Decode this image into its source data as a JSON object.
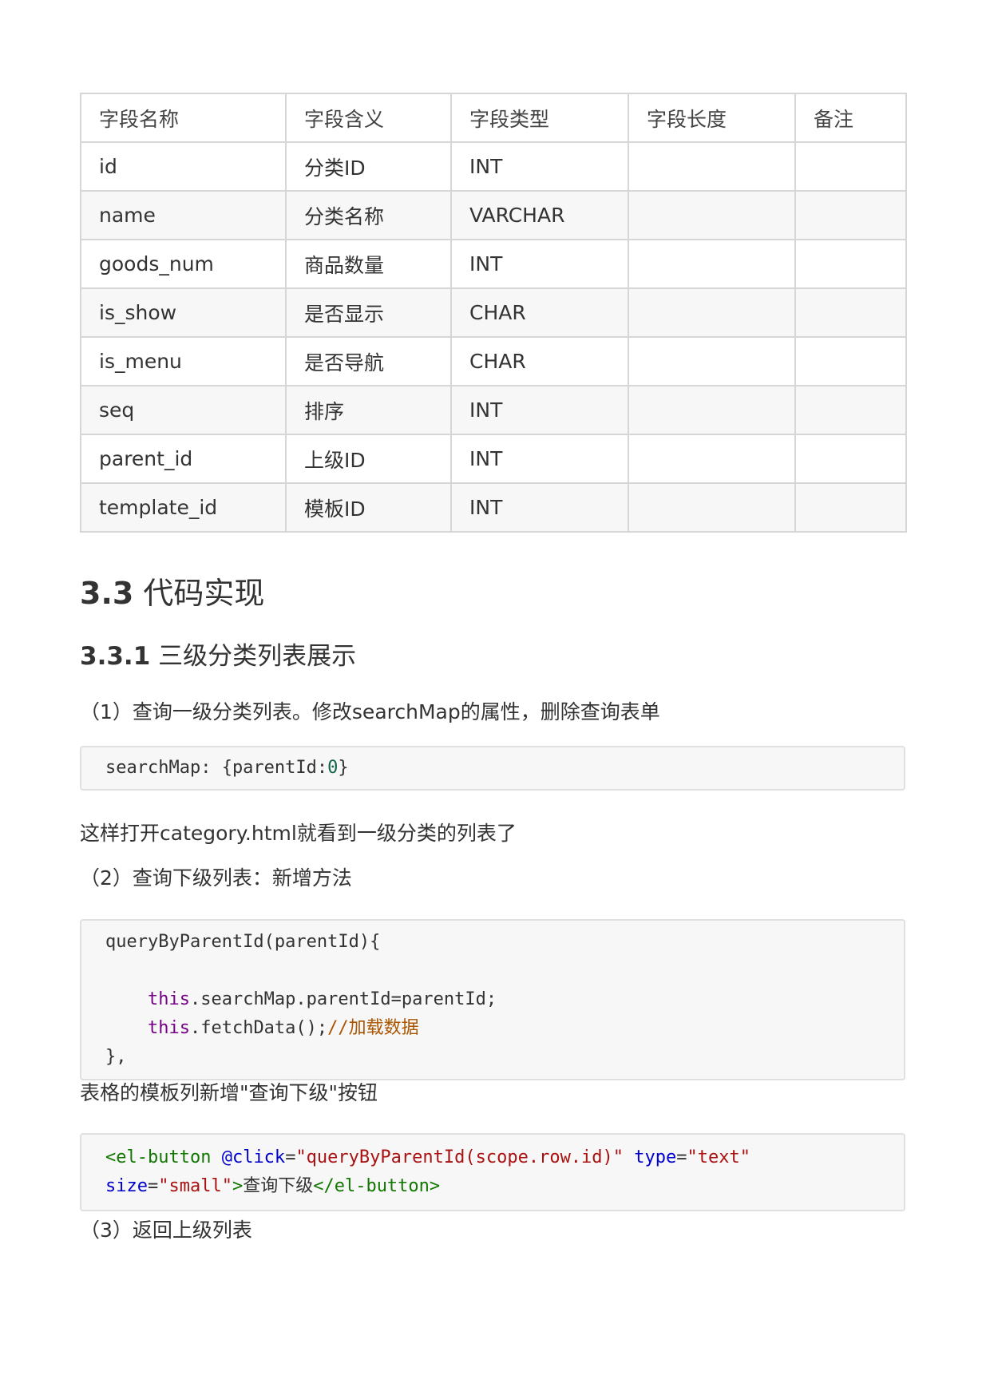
{
  "table": {
    "headers": [
      "字段名称",
      "字段含义",
      "字段类型",
      "字段长度",
      "备注"
    ],
    "rows": [
      [
        "id",
        "分类ID",
        "INT",
        "",
        ""
      ],
      [
        "name",
        "分类名称",
        "VARCHAR",
        "",
        ""
      ],
      [
        "goods_num",
        "商品数量",
        "INT",
        "",
        ""
      ],
      [
        "is_show",
        "是否显示",
        "CHAR",
        "",
        ""
      ],
      [
        "is_menu",
        "是否导航",
        "CHAR",
        "",
        ""
      ],
      [
        "seq",
        "排序",
        "INT",
        "",
        ""
      ],
      [
        "parent_id",
        "上级ID",
        "INT",
        "",
        ""
      ],
      [
        "template_id",
        "模板ID",
        "INT",
        "",
        ""
      ]
    ]
  },
  "section": {
    "number": "3.3",
    "title": "代码实现"
  },
  "subsection": {
    "number": "3.3.1",
    "title": "三级分类列表展示"
  },
  "para1": "（1）查询一级分类列表。修改searchMap的属性，删除查询表单",
  "code1": {
    "text": "searchMap: {parentId:",
    "num": "0",
    "close": "}"
  },
  "para2": "这样打开category.html就看到一级分类的列表了",
  "para3": "（2）查询下级列表：新增方法",
  "code2": {
    "line1": "queryByParentId(parentId){",
    "kw1": "this",
    "line3": ".searchMap.parentId=parentId;",
    "kw2": "this",
    "line4": ".fetchData();",
    "comment": "//加载数据",
    "line5": "},"
  },
  "para4": "表格的模板列新增\"查询下级\"按钮",
  "code3": {
    "tag_open": "<el-button",
    "attr1": "@click",
    "eq1": "=",
    "str1": "\"queryByParentId(scope.row.id)\"",
    "attr2": "type",
    "eq2": "=",
    "str2": "\"text\"",
    "attr3": "size",
    "eq3": "=",
    "str3": "\"small\"",
    "gt": ">",
    "content": "查询下级",
    "tag_close": "</el-button>"
  },
  "para5": "（3）返回上级列表"
}
